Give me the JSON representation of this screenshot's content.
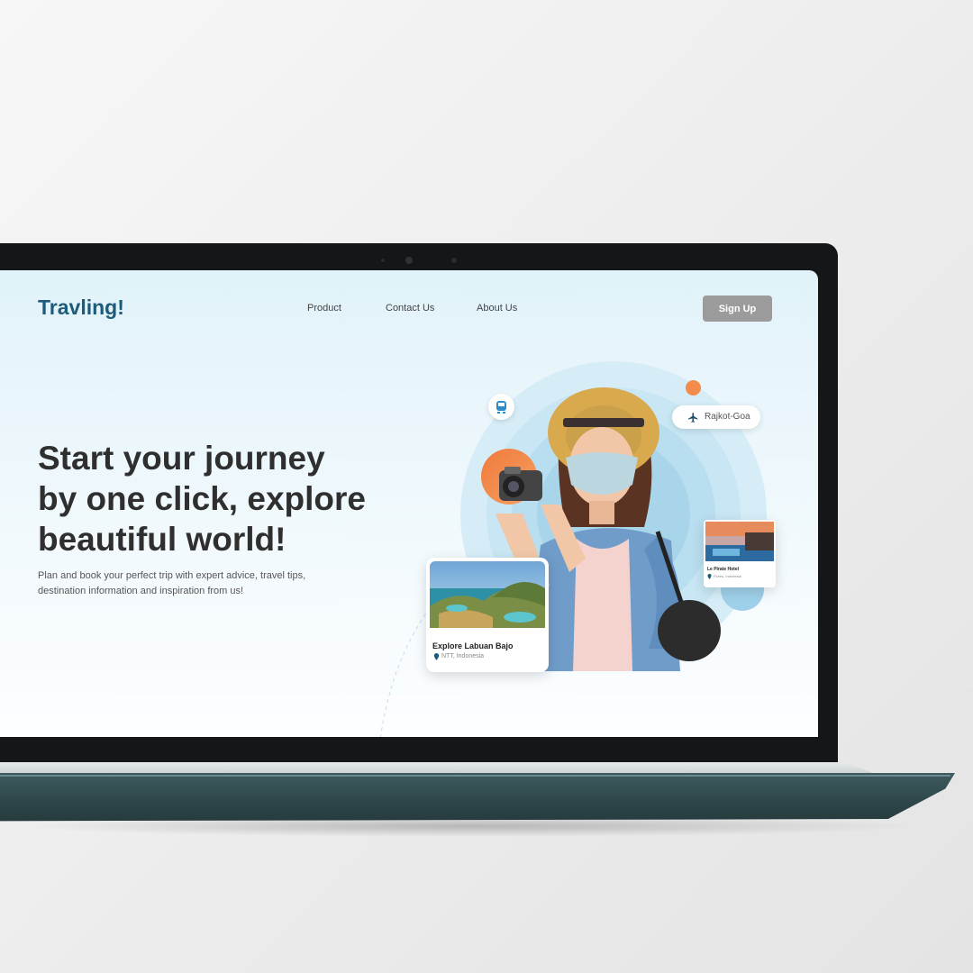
{
  "brand": {
    "logo": "Travling!"
  },
  "nav": {
    "items": [
      "Product",
      "Contact Us",
      "About Us"
    ]
  },
  "actions": {
    "signup_label": "Sign Up"
  },
  "hero": {
    "headline_lines": [
      "Start your journey",
      "by one click, explore",
      "beautiful world!"
    ],
    "subtext_lines": [
      "Plan and book your perfect trip with expert advice, travel tips,",
      "destination information and inspiration from us!"
    ]
  },
  "route_chip": {
    "label": "Rajkot-Goa",
    "icon": "airplane-icon"
  },
  "destination_card": {
    "title": "Explore Labuan Bajo",
    "location": "NTT, Indonesia",
    "icon": "location-pin-icon"
  },
  "hotel_card": {
    "title": "Le Pirate Hotel",
    "location": "Flores, Indonesia",
    "icon": "location-pin-icon"
  },
  "colors": {
    "brand": "#1d5b78",
    "accent_orange": "#f28b4b",
    "signup_bg": "#9b9b9b",
    "sky": "#e1f2f9"
  }
}
